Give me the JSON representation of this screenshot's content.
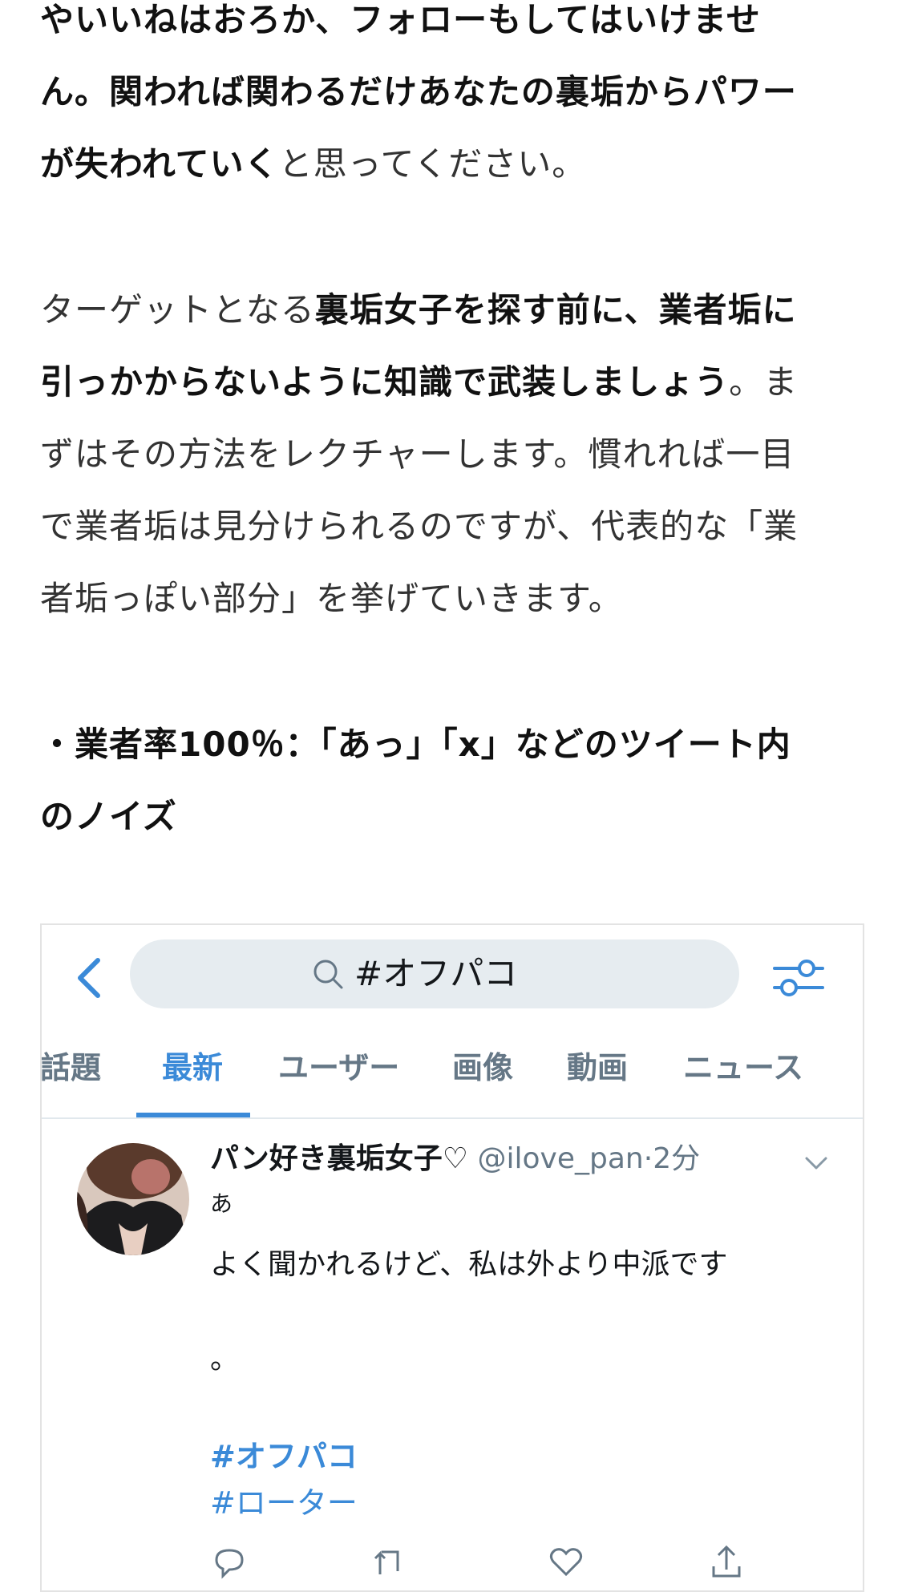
{
  "article": {
    "paragraph1": {
      "line1": "やいいねはおろか、フォローもしてはいけませ",
      "line2": "ん。関われば関わるだけあなたの裏垢からパワー",
      "line3_bold": "が失われていく",
      "line3_rest": "と思ってください。"
    },
    "paragraph2": {
      "line1_plain": "ターゲットとなる",
      "line1_bold": "裏垢女子を探す前に、業者垢に",
      "line2_bold": "引っかからないように知識で武装しましょう",
      "line2_rest": "。ま",
      "line3": "ずはその方法をレクチャーします。慣れれば一目",
      "line4": "で業者垢は見分けられるのですが、代表的な「業",
      "line5": "者垢っぽい部分」を挙げていきます。"
    },
    "heading": {
      "line1": "・業者率100％：「あっ」「x」などのツイート内",
      "line2": "のノイズ"
    }
  },
  "embed": {
    "search": {
      "value": "#オフパコ"
    },
    "tabs": [
      "話題",
      "最新",
      "ユーザー",
      "画像",
      "動画",
      "ニュース"
    ],
    "active_tab": "最新",
    "accent_color": "#3b8ad8",
    "tweet": {
      "display_name": "パン好き裏垢女子♡",
      "handle": "@ilove_pan",
      "separator": "·",
      "time": "2分",
      "text_line1": "あ",
      "text_line2": "よく聞かれるけど、私は外より中派です",
      "text_line3": "。",
      "hashtag1": "#オフパコ",
      "hashtag2": "#ローター"
    },
    "icons": [
      "back-chevron-icon",
      "search-icon",
      "filter-icon",
      "chevron-down-icon",
      "reply-icon",
      "retweet-icon",
      "like-icon",
      "share-icon"
    ]
  }
}
